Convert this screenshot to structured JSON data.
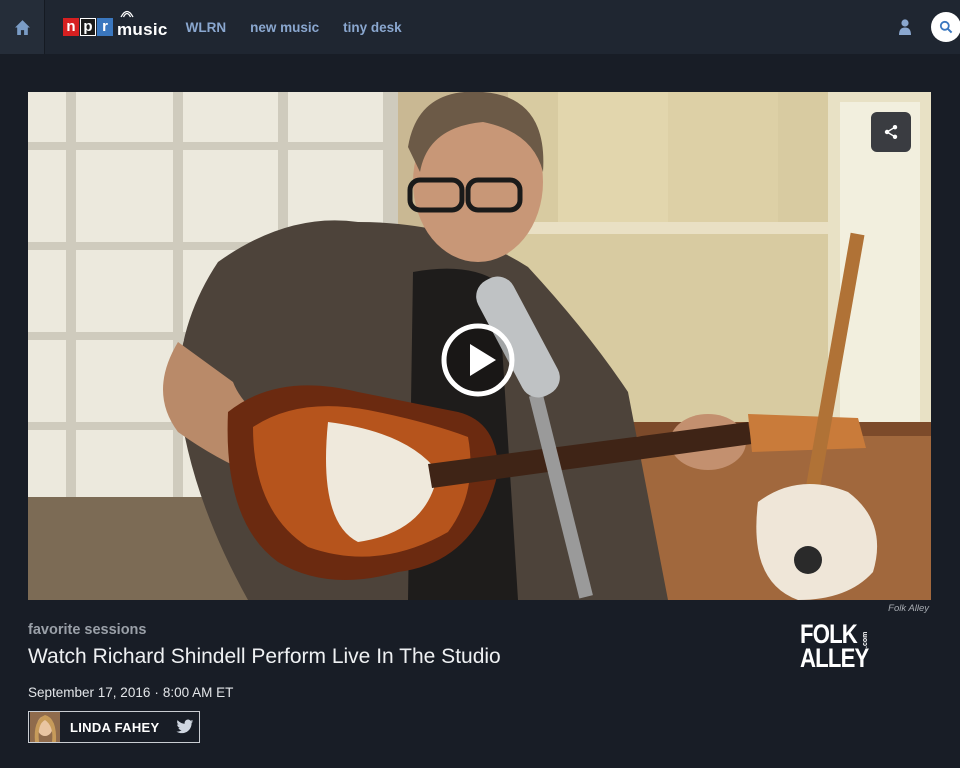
{
  "nav": {
    "home_icon": "home-icon",
    "logo": {
      "npr_letters": [
        "n",
        "p",
        "r"
      ],
      "music": "music"
    },
    "links": [
      "WLRN",
      "new music",
      "tiny desk"
    ],
    "user_icon": "user-icon",
    "search_icon": "search-icon"
  },
  "video": {
    "share_icon": "share-icon",
    "play_icon": "play-icon",
    "credit": "Folk Alley"
  },
  "article": {
    "category": "favorite sessions",
    "title": "Watch Richard Shindell Perform Live In The Studio",
    "date": "September 17, 2016",
    "time": "8:00 AM ET",
    "author": "LINDA FAHEY",
    "twitter_icon": "twitter-icon"
  },
  "brand_logo": {
    "line1": "FOLK",
    "line2": "ALLEY",
    "suffix": ".com"
  },
  "colors": {
    "background": "#181d26",
    "nav_background": "#1f2631",
    "nav_link": "#8aa7cf",
    "npr_red": "#d62021",
    "npr_blue": "#3a77bf"
  }
}
